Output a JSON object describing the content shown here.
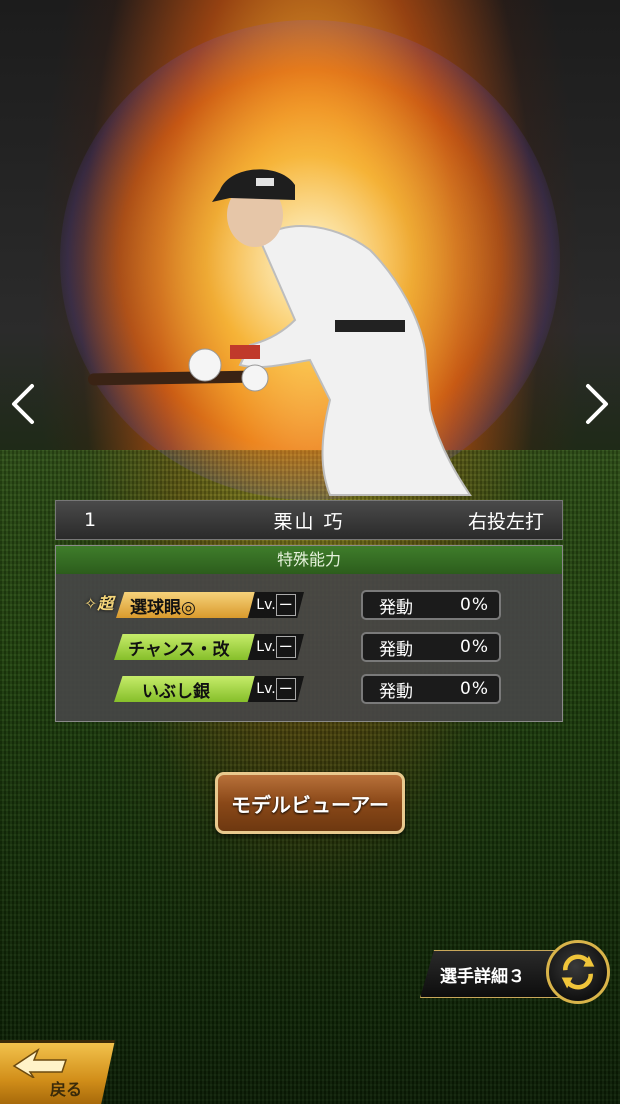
{
  "player": {
    "number": "1",
    "name": "栗山 巧",
    "handedness": "右投左打"
  },
  "abilities": {
    "header": "特殊能力",
    "super_mark": "超",
    "items": [
      {
        "name": "選球眼◎",
        "lv": "Lv.",
        "lv_value": "ー",
        "trigger_label": "発動",
        "trigger_value": "0%",
        "color": "#e0a73a"
      },
      {
        "name": "チャンス・改",
        "lv": "Lv.",
        "lv_value": "ー",
        "trigger_label": "発動",
        "trigger_value": "0%",
        "color": "#9ccf3a"
      },
      {
        "name": "いぶし銀",
        "lv": "Lv.",
        "lv_value": "ー",
        "trigger_label": "発動",
        "trigger_value": "0%",
        "color": "#9ccf3a"
      }
    ]
  },
  "buttons": {
    "model_viewer": "モデルビューアー",
    "player_detail": "選手詳細３",
    "back": "戻る"
  },
  "colors": {
    "accent_gold": "#d9b44a",
    "header_green": "#3f7d2b"
  }
}
